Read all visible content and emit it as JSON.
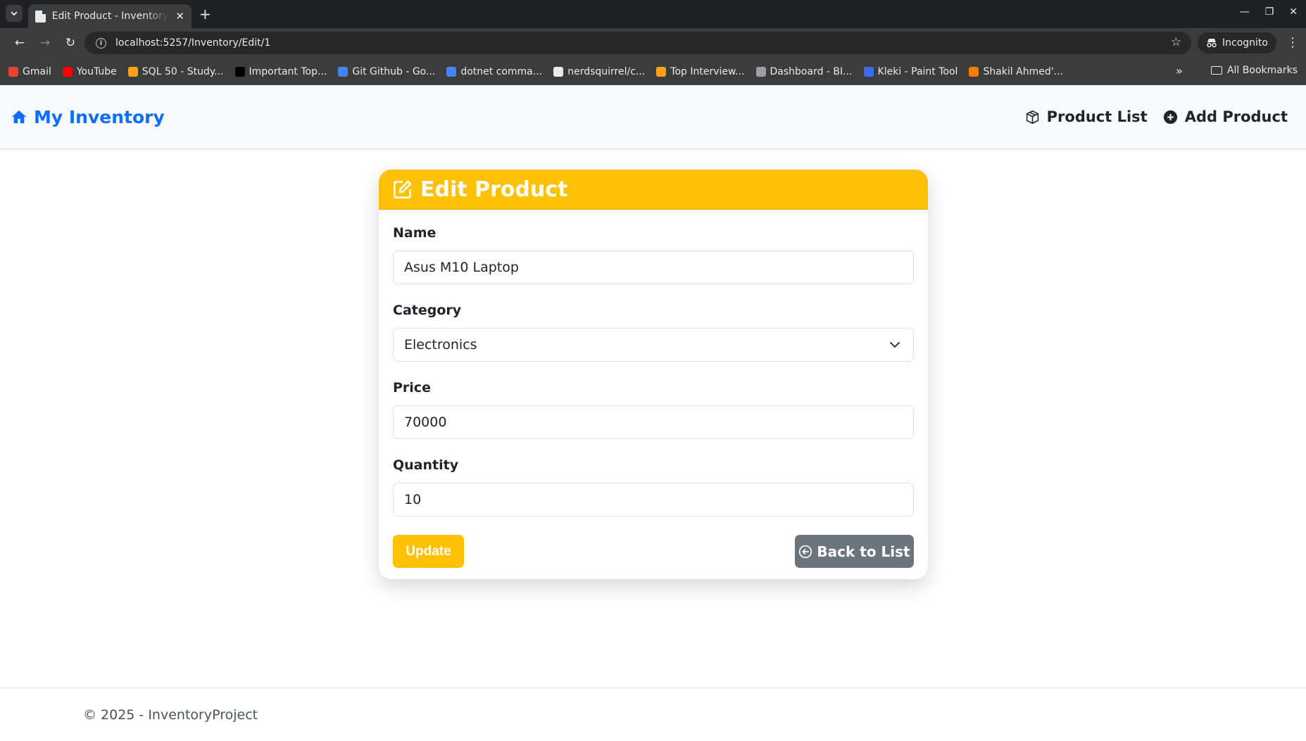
{
  "browser": {
    "tab_title": "Edit Product - InventoryProject",
    "url": "localhost:5257/Inventory/Edit/1",
    "profile": "Incognito",
    "bookmarks": [
      {
        "label": "Gmail",
        "color": "#ea4335"
      },
      {
        "label": "YouTube",
        "color": "#ff0000"
      },
      {
        "label": "SQL 50 - Study...",
        "color": "#ffa116"
      },
      {
        "label": "Important Top...",
        "color": "#000000"
      },
      {
        "label": "Git Github - Go...",
        "color": "#4285f4"
      },
      {
        "label": "dotnet comma...",
        "color": "#4285f4"
      },
      {
        "label": "nerdsquirrel/c...",
        "color": "#e8eaed"
      },
      {
        "label": "Top Interview...",
        "color": "#ffa116"
      },
      {
        "label": "Dashboard - BI...",
        "color": "#9aa0a6"
      },
      {
        "label": "Kleki - Paint Tool",
        "color": "#3b6cf6"
      },
      {
        "label": "Shakil Ahmed'...",
        "color": "#f57d00"
      }
    ],
    "all_bookmarks": "All Bookmarks"
  },
  "app": {
    "brand": "My Inventory",
    "nav": {
      "product_list": "Product List",
      "add_product": "Add Product"
    },
    "accent_color": "#ffc107",
    "brand_color": "#0d6efd"
  },
  "form": {
    "title": "Edit Product",
    "name_label": "Name",
    "name_value": "Asus M10 Laptop",
    "category_label": "Category",
    "category_value": "Electronics",
    "price_label": "Price",
    "price_value": "70000",
    "quantity_label": "Quantity",
    "quantity_value": "10",
    "update_label": "Update",
    "back_label": "Back to List"
  },
  "footer": {
    "text": "© 2025 - InventoryProject"
  }
}
